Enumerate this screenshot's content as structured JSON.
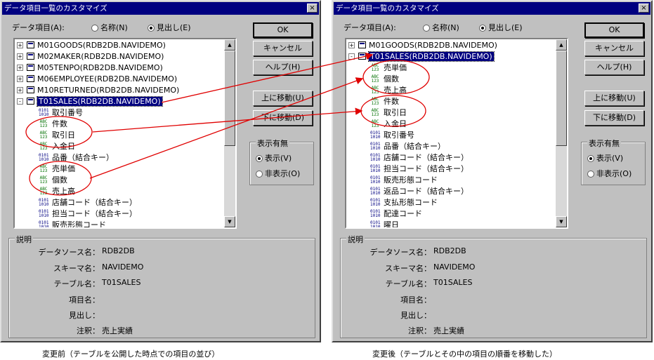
{
  "dialogs": [
    {
      "title": "データ項目一覧のカスタマイズ",
      "close_glyph": "×",
      "field_label": "データ項目(A):",
      "radio_name": "名称(N)",
      "radio_heading": "見出し(E)",
      "tree_rows": [
        {
          "kind": "table",
          "expander": "+",
          "label": "M01GOODS(RDB2DB.NAVIDEMO)"
        },
        {
          "kind": "table",
          "expander": "+",
          "label": "M02MAKER(RDB2DB.NAVIDEMO)"
        },
        {
          "kind": "table",
          "expander": "+",
          "label": "M05TENPO(RDB2DB.NAVIDEMO)"
        },
        {
          "kind": "table",
          "expander": "+",
          "label": "M06EMPLOYEE(RDB2DB.NAVIDEMO)"
        },
        {
          "kind": "table",
          "expander": "+",
          "label": "M10RETURNED(RDB2DB.NAVIDEMO)"
        },
        {
          "kind": "table",
          "expander": "-",
          "label": "T01SALES(RDB2DB.NAVIDEMO)",
          "selected": true
        },
        {
          "kind": "num",
          "label": "取引番号"
        },
        {
          "kind": "abc",
          "label": "件数"
        },
        {
          "kind": "abc",
          "label": "取引日"
        },
        {
          "kind": "abc",
          "label": "入金日"
        },
        {
          "kind": "num",
          "label": "品番（結合キー）"
        },
        {
          "kind": "abc",
          "label": "売単価"
        },
        {
          "kind": "abc",
          "label": "個数"
        },
        {
          "kind": "abc",
          "label": "売上高"
        },
        {
          "kind": "num",
          "label": "店舗コード（結合キー）"
        },
        {
          "kind": "num",
          "label": "担当コード（結合キー）"
        },
        {
          "kind": "num",
          "label": "販売形態コード"
        }
      ],
      "buttons": {
        "ok": "OK",
        "cancel": "キャンセル",
        "help": "ヘルプ(H)",
        "move_up": "上に移動(U)",
        "move_down": "下に移動(D)"
      },
      "display_group": {
        "title": "表示有無",
        "show": "表示(V)",
        "hide": "非表示(O)"
      },
      "description": {
        "title": "説明",
        "labels": [
          "データソース名：",
          "スキーマ名：",
          "テーブル名：",
          "項目名：",
          "見出し：",
          "注釈："
        ],
        "values": [
          "RDB2DB",
          "NAVIDEMO",
          "T01SALES",
          "",
          "",
          "売上実績"
        ]
      },
      "caption": "変更前（テーブルを公開した時点での項目の並び）"
    },
    {
      "title": "データ項目一覧のカスタマイズ",
      "close_glyph": "×",
      "field_label": "データ項目(A):",
      "radio_name": "名称(N)",
      "radio_heading": "見出し(E)",
      "tree_rows": [
        {
          "kind": "table",
          "expander": "+",
          "label": "M01GOODS(RDB2DB.NAVIDEMO)"
        },
        {
          "kind": "table",
          "expander": "-",
          "label": "T01SALES(RDB2DB.NAVIDEMO)",
          "selected": true
        },
        {
          "kind": "abc",
          "label": "売単価"
        },
        {
          "kind": "abc",
          "label": "個数"
        },
        {
          "kind": "abc",
          "label": "売上高"
        },
        {
          "kind": "abc",
          "label": "件数"
        },
        {
          "kind": "abc",
          "label": "取引日"
        },
        {
          "kind": "abc",
          "label": "入金日"
        },
        {
          "kind": "num",
          "label": "取引番号"
        },
        {
          "kind": "num",
          "label": "品番（結合キー）"
        },
        {
          "kind": "num",
          "label": "店舗コード（結合キー）"
        },
        {
          "kind": "num",
          "label": "担当コード（結合キー）"
        },
        {
          "kind": "num",
          "label": "販売形態コード"
        },
        {
          "kind": "num",
          "label": "返品コード（結合キー）"
        },
        {
          "kind": "num",
          "label": "支払形態コード"
        },
        {
          "kind": "num",
          "label": "配達コード"
        },
        {
          "kind": "num",
          "label": "曜日"
        }
      ],
      "buttons": {
        "ok": "OK",
        "cancel": "キャンセル",
        "help": "ヘルプ(H)",
        "move_up": "上に移動(U)",
        "move_down": "下に移動(D)"
      },
      "display_group": {
        "title": "表示有無",
        "show": "表示(V)",
        "hide": "非表示(O)"
      },
      "description": {
        "title": "説明",
        "labels": [
          "データソース名：",
          "スキーマ名：",
          "テーブル名：",
          "項目名：",
          "見出し：",
          "注釈："
        ],
        "values": [
          "RDB2DB",
          "NAVIDEMO",
          "T01SALES",
          "",
          "",
          "売上実績"
        ]
      },
      "caption": "変更後（テーブルとその中の項目の順番を移動した）"
    }
  ],
  "icons": {
    "num_line1": "0101",
    "num_line2": "1010",
    "abc_line1": "ABC",
    "abc_line2": "123"
  },
  "colors": {
    "titlebar": "#000080",
    "selection": "#000080",
    "annotation": "#e00000"
  }
}
